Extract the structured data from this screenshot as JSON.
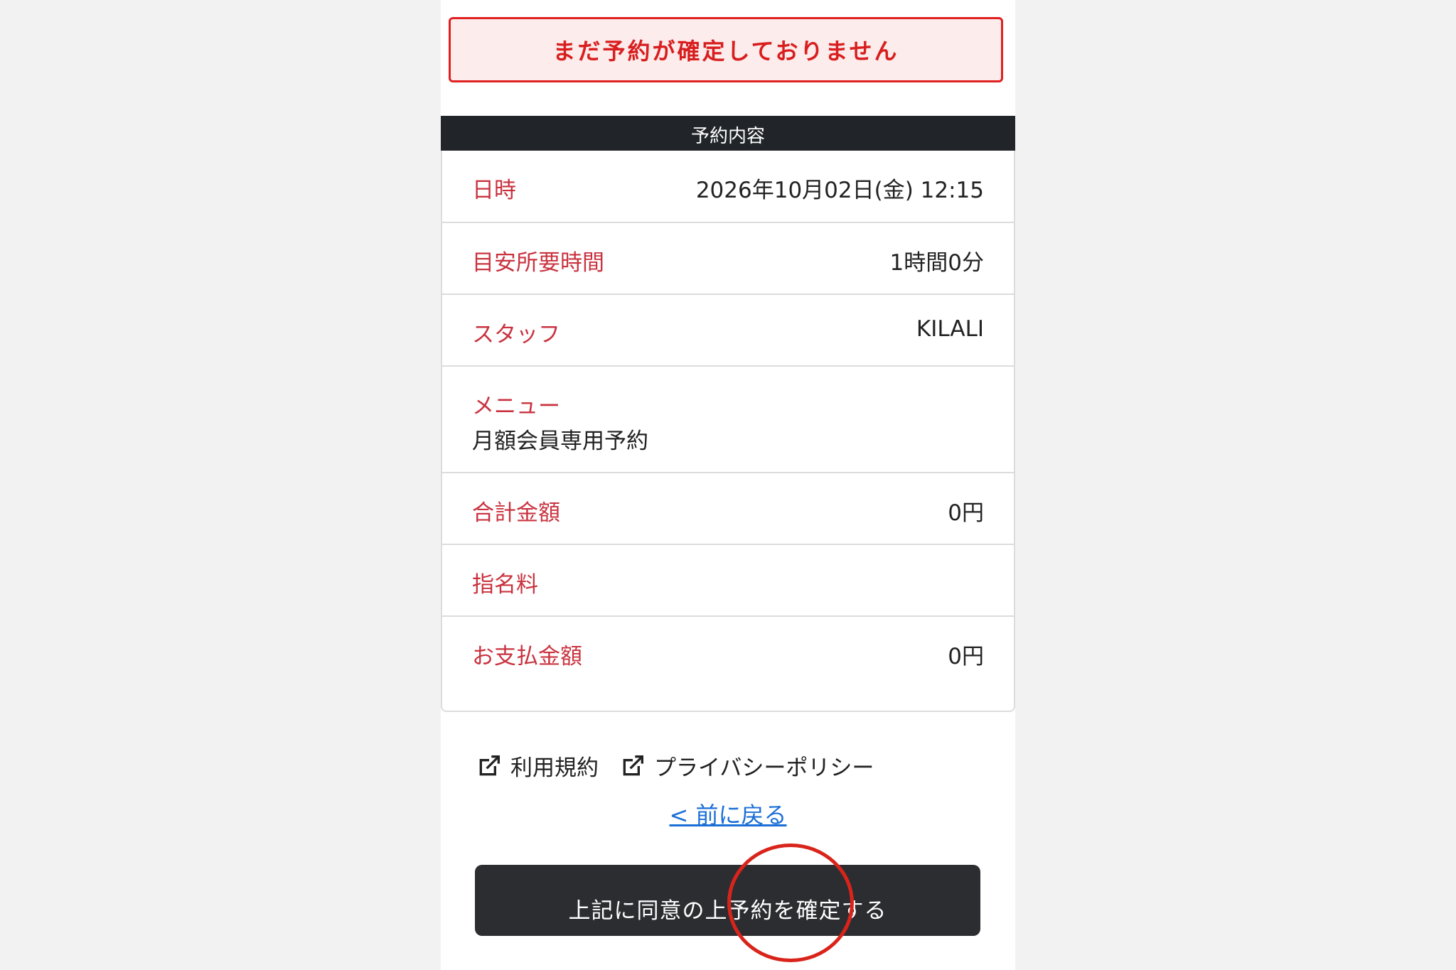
{
  "alert": {
    "text": "まだ予約が確定しておりません"
  },
  "section": {
    "title": "予約内容"
  },
  "details": {
    "datetime": {
      "label": "日時",
      "value": "2026年10月02日(金) 12:15"
    },
    "duration": {
      "label": "目安所要時間",
      "value": "1時間0分"
    },
    "staff": {
      "label": "スタッフ",
      "value": "KILALI"
    },
    "menu": {
      "label": "メニュー",
      "value": "月額会員専用予約"
    },
    "total": {
      "label": "合計金額",
      "value": "0円"
    },
    "nomination": {
      "label": "指名料",
      "value": ""
    },
    "payment": {
      "label": "お支払金額",
      "value": "0円"
    }
  },
  "links": {
    "terms": "利用規約",
    "privacy": "プライバシーポリシー",
    "back": "< 前に戻る"
  },
  "confirm_button": {
    "label": "上記に同意の上予約を確定する"
  },
  "colors": {
    "alert_text": "#d81e1e",
    "alert_bg": "#fdecec",
    "label": "#c9333f",
    "header_bg": "#212529",
    "link": "#1a6fd6",
    "button_bg": "#2c2d31",
    "annotation_circle": "#d9241b"
  }
}
